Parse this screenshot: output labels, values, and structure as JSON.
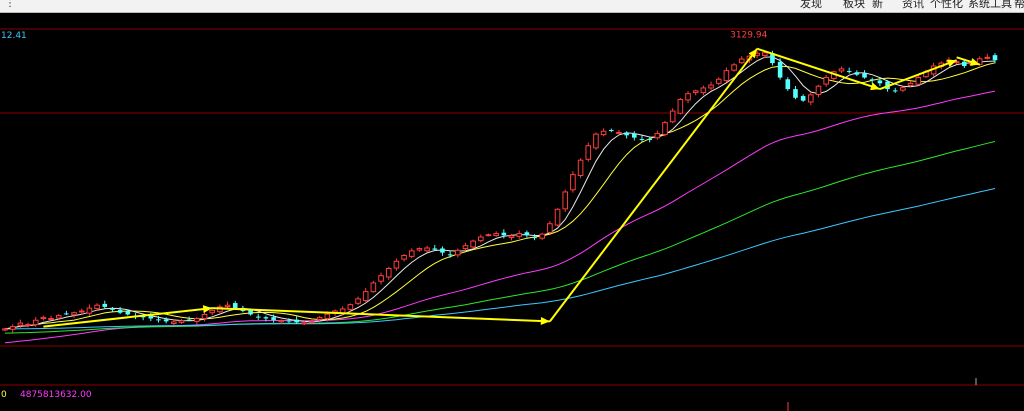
{
  "topbar": {
    "menu_items": [
      "发现",
      "板块",
      "新",
      "资讯",
      "个性化",
      "系统工具",
      "帮"
    ]
  },
  "chart_data": {
    "type": "candlestick",
    "y_top_label": "12.41",
    "peak_label": "3129.94",
    "volume_left_label": "0",
    "volume_label": "4875813632.00",
    "colors": {
      "up": "#ff3c3c",
      "down": "#54ffff",
      "ma5": "#e8e8e8",
      "ma10": "#ffff3c",
      "ma30": "#ff3cff",
      "ma60": "#2ee62e",
      "ma120": "#3cc8ff",
      "trend": "#ffff00",
      "grid": "#8b0000"
    },
    "closes": [
      2160,
      2168,
      2180,
      2175,
      2190,
      2200,
      2196,
      2206,
      2212,
      2216,
      2222,
      2232,
      2242,
      2236,
      2226,
      2216,
      2210,
      2205,
      2200,
      2196,
      2190,
      2186,
      2184,
      2188,
      2192,
      2196,
      2210,
      2224,
      2236,
      2242,
      2232,
      2222,
      2210,
      2202,
      2196,
      2191,
      2189,
      2186,
      2183,
      2181,
      2185,
      2199,
      2211,
      2222,
      2229,
      2244,
      2264,
      2289,
      2319,
      2344,
      2369,
      2394,
      2414,
      2430,
      2438,
      2440,
      2434,
      2424,
      2416,
      2432,
      2448,
      2464,
      2478,
      2486,
      2490,
      2484,
      2482,
      2490,
      2484,
      2474,
      2488,
      2524,
      2574,
      2634,
      2694,
      2744,
      2794,
      2834,
      2844,
      2846,
      2840,
      2830,
      2822,
      2816,
      2814,
      2836,
      2874,
      2914,
      2954,
      2974,
      2984,
      2994,
      3004,
      3024,
      3054,
      3074,
      3094,
      3104,
      3114,
      3116,
      3080,
      3030,
      2990,
      2960,
      2950,
      2970,
      3000,
      3030,
      3050,
      3060,
      3050,
      3040,
      3030,
      3020,
      3010,
      2990,
      2985,
      2995,
      3010,
      3030,
      3050,
      3070,
      3080,
      3090,
      3085,
      3070,
      3080,
      3095,
      3100,
      3090
    ],
    "trendlines": [
      {
        "from": [
          5,
          2168
        ],
        "to": [
          27,
          2232
        ]
      },
      {
        "from": [
          27,
          2232
        ],
        "to": [
          71,
          2186
        ]
      },
      {
        "from": [
          71,
          2186
        ],
        "to": [
          98,
          3129.94
        ]
      },
      {
        "from": [
          98,
          3129.94
        ],
        "to": [
          114,
          2990
        ]
      },
      {
        "from": [
          114,
          2990
        ],
        "to": [
          124,
          3090
        ]
      },
      {
        "from": [
          124,
          3100
        ],
        "to": [
          127,
          3075
        ]
      }
    ]
  }
}
